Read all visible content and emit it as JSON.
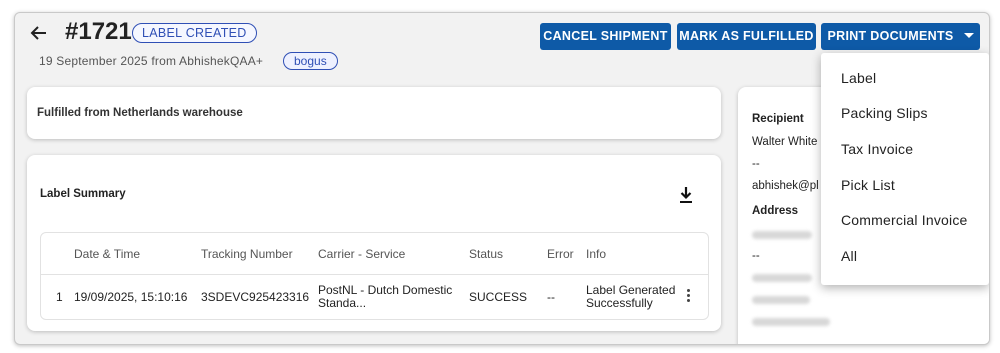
{
  "header": {
    "order_id": "#1721",
    "status_badge": "LABEL CREATED",
    "subline": "19 September 2025 from AbhishekQAA+",
    "tag": "bogus",
    "buttons": {
      "cancel": "CANCEL SHIPMENT",
      "fulfill": "MARK AS FULFILLED",
      "print": "PRINT DOCUMENTS"
    }
  },
  "fulfilled_card": {
    "text": "Fulfilled from Netherlands warehouse"
  },
  "label_summary": {
    "title": "Label Summary",
    "columns": [
      "Date & Time",
      "Tracking Number",
      "Carrier - Service",
      "Status",
      "Error",
      "Info"
    ],
    "rows": [
      {
        "index": "1",
        "datetime": "19/09/2025, 15:10:16",
        "tracking": "3SDEVC925423316",
        "carrier_line1": "PostNL - Dutch Domestic",
        "carrier_line2": "Standa...",
        "status": "SUCCESS",
        "error": "--",
        "info_line1": "Label Generated",
        "info_line2": "Successfully"
      }
    ]
  },
  "recipient": {
    "label": "Recipient",
    "name": "Walter White",
    "phone": "--",
    "email": "abhishek@pl",
    "address_label": "Address",
    "address_line2": "--"
  },
  "print_menu": {
    "items": [
      "Label",
      "Packing Slips",
      "Tax Invoice",
      "Pick List",
      "Commercial Invoice",
      "All"
    ]
  },
  "colors": {
    "primary": "#0e5aa7",
    "badge": "#2f4fb5"
  }
}
